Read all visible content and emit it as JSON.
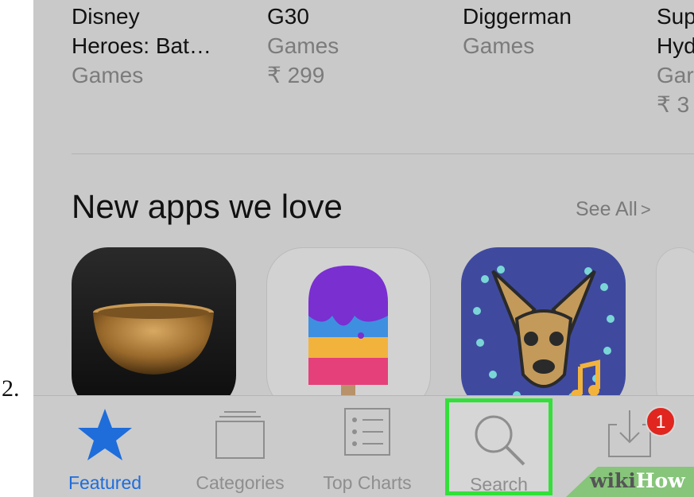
{
  "step_number": "2.",
  "top_apps": [
    {
      "name_lines": [
        "Disney",
        "Heroes: Bat…"
      ],
      "meta_lines": [
        "Games"
      ]
    },
    {
      "name_lines": [
        "G30"
      ],
      "meta_lines": [
        "Games",
        "₹ 299"
      ]
    },
    {
      "name_lines": [
        "Diggerman"
      ],
      "meta_lines": [
        "Games"
      ]
    },
    {
      "name_lines": [
        "Sup",
        "Hyd"
      ],
      "meta_lines": [
        "Gar",
        "₹ 3"
      ]
    }
  ],
  "section": {
    "title": "New apps we love",
    "see_all": "See All",
    "see_all_icon": "chevron-right-icon"
  },
  "tabs": [
    {
      "label": "Featured",
      "icon": "star-icon",
      "active": true
    },
    {
      "label": "Categories",
      "icon": "categories-icon",
      "active": false
    },
    {
      "label": "Top Charts",
      "icon": "list-icon",
      "active": false
    },
    {
      "label": "Search",
      "icon": "search-icon",
      "active": false,
      "highlighted": true
    },
    {
      "label": "",
      "icon": "updates-icon",
      "active": false
    }
  ],
  "updates_badge": "1",
  "watermark": {
    "part1": "wiki",
    "part2": "How"
  },
  "colors": {
    "accent": "#1e6ddb",
    "highlight": "#33e03a",
    "badge": "#e0261e",
    "background": "#c9c9c9"
  }
}
